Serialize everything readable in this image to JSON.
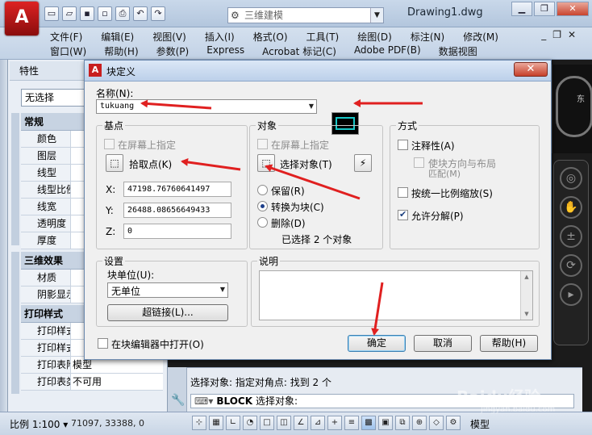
{
  "app": {
    "logo": "A",
    "workspace": "三维建模",
    "doc_title": "Drawing1.dwg"
  },
  "menu": {
    "row1": [
      "文件(F)",
      "编辑(E)",
      "视图(V)",
      "插入(I)",
      "格式(O)",
      "工具(T)",
      "绘图(D)",
      "标注(N)",
      "修改(M)"
    ],
    "row2": [
      "窗口(W)",
      "帮助(H)",
      "参数(P)",
      "Express",
      "Acrobat 标记(C)",
      "Adobe PDF(B)",
      "数据视图"
    ]
  },
  "properties": {
    "title": "特性",
    "selection": "无选择",
    "groups": [
      {
        "title": "常规",
        "rows": [
          "颜色",
          "图层",
          "线型",
          "线型比例",
          "线宽",
          "透明度",
          "厚度"
        ]
      },
      {
        "title": "三维效果",
        "rows": [
          "材质",
          "阴影显示"
        ]
      },
      {
        "title": "打印样式",
        "rows": [
          "打印样式",
          "打印样式表",
          "打印表附...",
          "打印表类型"
        ]
      }
    ],
    "extra_values": {
      "attach": "模型",
      "table_type": "不可用"
    }
  },
  "nav": {
    "east": "东"
  },
  "dialog": {
    "title": "块定义",
    "close": "✕",
    "name_label": "名称(N):",
    "name_value": "tukuang",
    "base": {
      "title": "基点",
      "on_screen": "在屏幕上指定",
      "pick_point": "拾取点(K)",
      "x_label": "X:",
      "x_value": "47198.76760641497",
      "y_label": "Y:",
      "y_value": "26488.08656649433",
      "z_label": "Z:",
      "z_value": "0"
    },
    "objects": {
      "title": "对象",
      "on_screen": "在屏幕上指定",
      "select": "选择对象(T)",
      "retain": "保留(R)",
      "convert": "转换为块(C)",
      "delete": "删除(D)",
      "selected": "已选择 2 个对象"
    },
    "behavior": {
      "title": "方式",
      "annotative": "注释性(A)",
      "orient": "使块方向与布局",
      "orient2": "匹配(M)",
      "uniform": "按统一比例缩放(S)",
      "explode": "允许分解(P)"
    },
    "settings": {
      "title": "设置",
      "unit_label": "块单位(U):",
      "unit_value": "无单位",
      "hyperlink": "超链接(L)..."
    },
    "description": {
      "title": "说明"
    },
    "open_in_editor": "在块编辑器中打开(O)",
    "ok": "确定",
    "cancel": "取消",
    "help": "帮助(H)"
  },
  "command": {
    "history": "选择对象: 指定对角点: 找到 2 个",
    "prompt_cmd": "BLOCK",
    "prompt_text": "选择对象:"
  },
  "status": {
    "scale": "比例 1:100",
    "coords": "71097, 33388, 0",
    "model": "模型"
  },
  "watermark": {
    "text": "Baidu经验",
    "sub": "jingyan.baidu.com"
  },
  "colors": {
    "annotation_arrow": "#e02020",
    "accent": "#c81f1f"
  }
}
